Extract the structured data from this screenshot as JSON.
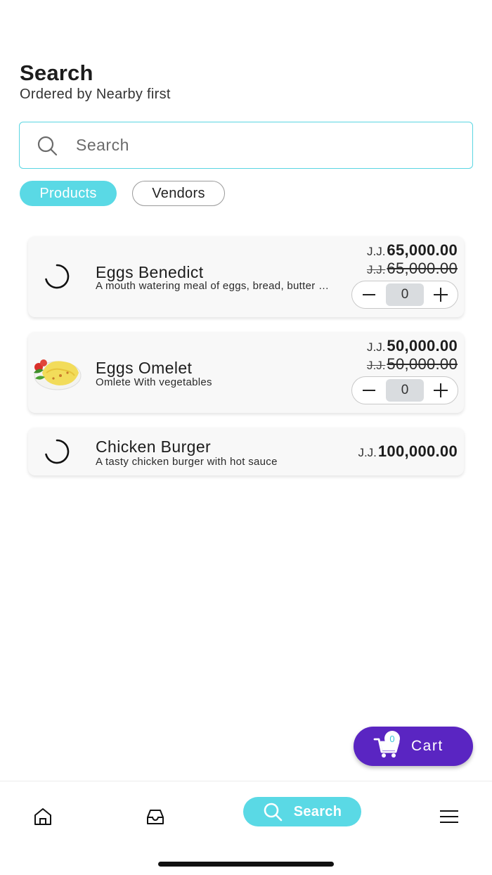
{
  "header": {
    "title": "Search",
    "subtitle": "Ordered by Nearby first"
  },
  "search": {
    "placeholder": "Search",
    "value": ""
  },
  "filters": {
    "products_label": "Products",
    "vendors_label": "Vendors",
    "active": "Products"
  },
  "products": [
    {
      "name": "Eggs Benedict",
      "description": "A mouth watering meal of eggs, bread, butter an...",
      "currency": "J.J.",
      "price": "65,000.00",
      "old_price": "65,000.00",
      "quantity": "0",
      "image": "loading-spinner-icon"
    },
    {
      "name": "Eggs Omelet",
      "description": "Omlete With vegetables",
      "currency": "J.J.",
      "price": "50,000.00",
      "old_price": "50,000.00",
      "quantity": "0",
      "image": "omelet-photo"
    },
    {
      "name": "Chicken Burger",
      "description": "A tasty chicken burger with hot sauce",
      "currency": "J.J.",
      "price": "100,000.00",
      "image": "loading-spinner-icon"
    }
  ],
  "cart": {
    "label": "Cart",
    "count": "0"
  },
  "bottom_nav": {
    "search_label": "Search",
    "items": [
      "home-icon",
      "inbox-icon",
      "search-icon",
      "menu-icon"
    ]
  },
  "colors": {
    "accent": "#5ad9e5",
    "cart": "#5a25c2"
  }
}
